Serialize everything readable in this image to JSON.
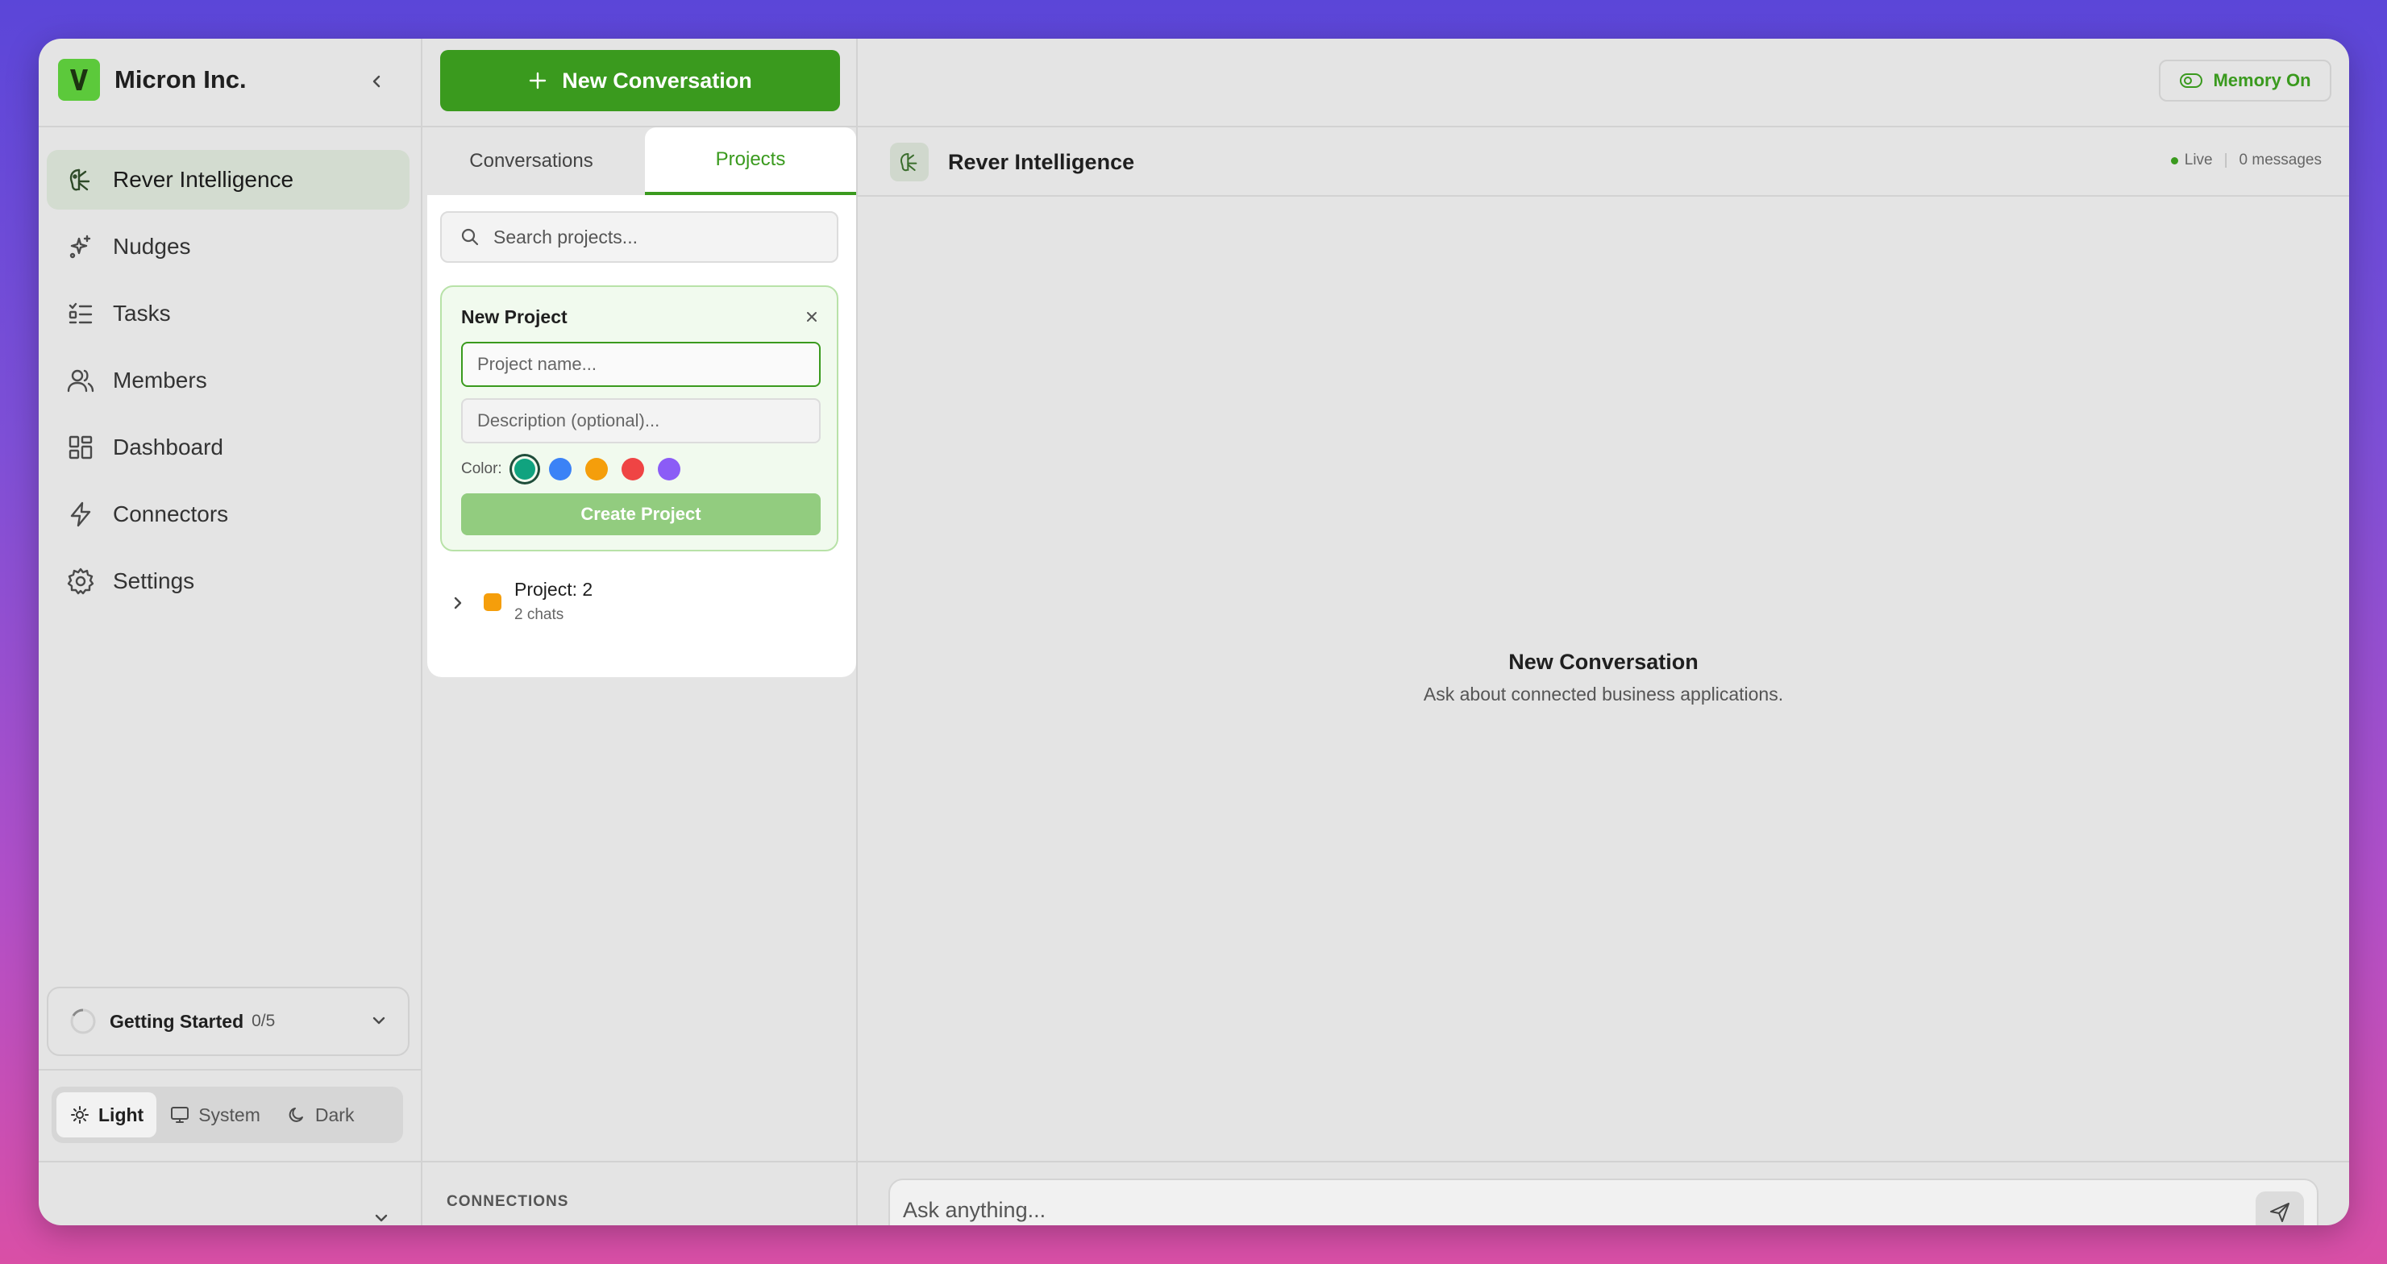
{
  "brand": {
    "name": "Micron Inc.",
    "logo_icon": "micron-logo-icon",
    "accent": "#5cc93b"
  },
  "sidebar": {
    "items": [
      {
        "label": "Rever Intelligence",
        "icon": "brain-icon",
        "active": true
      },
      {
        "label": "Nudges",
        "icon": "sparkles-icon"
      },
      {
        "label": "Tasks",
        "icon": "checklist-icon"
      },
      {
        "label": "Members",
        "icon": "users-icon"
      },
      {
        "label": "Dashboard",
        "icon": "dashboard-icon"
      },
      {
        "label": "Connectors",
        "icon": "zap-icon"
      },
      {
        "label": "Settings",
        "icon": "gear-icon"
      }
    ],
    "getting_started": {
      "title": "Getting Started",
      "count": "0/5"
    },
    "theme": {
      "light": "Light",
      "system": "System",
      "dark": "Dark",
      "selected": "Light"
    }
  },
  "middle": {
    "new_conversation_label": "New Conversation",
    "tabs": {
      "conversations": "Conversations",
      "projects": "Projects",
      "active": "Projects"
    },
    "search": {
      "placeholder": "Search projects..."
    },
    "new_project": {
      "title": "New Project",
      "name_placeholder": "Project name...",
      "description_placeholder": "Description (optional)...",
      "color_label": "Color:",
      "colors": [
        "#10a37f",
        "#3b82f6",
        "#f59e0b",
        "#ef4444",
        "#8b5cf6"
      ],
      "selected_color": "#10a37f",
      "create_label": "Create Project"
    },
    "projects": [
      {
        "name": "Project: 2",
        "subtitle": "2 chats",
        "color": "#f59e0b"
      }
    ],
    "connections_label": "CONNECTIONS"
  },
  "main": {
    "memory_label": "Memory On",
    "header": {
      "title": "Rever Intelligence",
      "status": "Live",
      "messages": "0 messages"
    },
    "empty": {
      "title": "New Conversation",
      "subtitle": "Ask about connected business applications."
    },
    "composer": {
      "placeholder": "Ask anything..."
    }
  },
  "colors": {
    "primary_green": "#3a9a1e",
    "button_disabled_green": "#92cc7f",
    "background": "#e4e4e4"
  }
}
